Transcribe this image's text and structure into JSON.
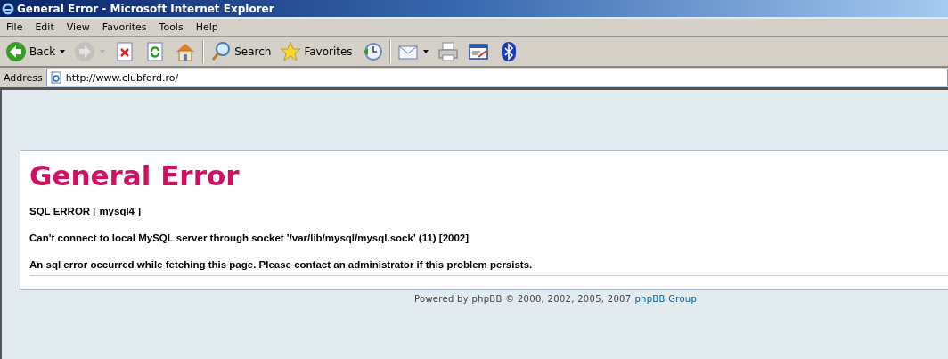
{
  "window": {
    "title": "General Error - Microsoft Internet Explorer"
  },
  "menu": [
    "File",
    "Edit",
    "View",
    "Favorites",
    "Tools",
    "Help"
  ],
  "toolbar": [
    {
      "kind": "back",
      "label": "Back",
      "dropdown": true,
      "disabled": false
    },
    {
      "kind": "forward",
      "dropdown": true,
      "disabled": true
    },
    {
      "kind": "stop",
      "disabled": false
    },
    {
      "kind": "refresh",
      "disabled": false
    },
    {
      "kind": "home",
      "disabled": false
    },
    {
      "kind": "separator"
    },
    {
      "kind": "search",
      "label": "Search",
      "disabled": false
    },
    {
      "kind": "favorites",
      "label": "Favorites",
      "disabled": false
    },
    {
      "kind": "history",
      "disabled": false
    },
    {
      "kind": "separator"
    },
    {
      "kind": "mail",
      "dropdown": true,
      "disabled": false
    },
    {
      "kind": "print",
      "disabled": false
    },
    {
      "kind": "edit",
      "disabled": false
    },
    {
      "kind": "bluetooth",
      "disabled": false
    }
  ],
  "address": {
    "label": "Address",
    "value": "http://www.clubford.ro/"
  },
  "page": {
    "heading": "General Error",
    "lines": [
      "SQL ERROR [ mysql4 ]",
      "Can't connect to local MySQL server through socket '/var/lib/mysql/mysql.sock' (11) [2002]",
      "An sql error occurred while fetching this page. Please contact an administrator if this problem persists."
    ],
    "footer": {
      "text": "Powered by phpBB © 2000, 2002, 2005, 2007",
      "link": "phpBB Group"
    }
  }
}
